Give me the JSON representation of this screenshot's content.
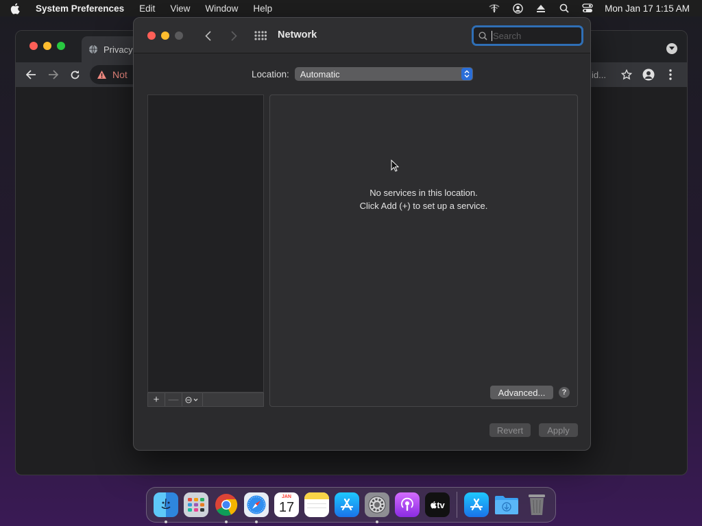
{
  "menubar": {
    "app_name": "System Preferences",
    "menus": [
      "Edit",
      "View",
      "Window",
      "Help"
    ],
    "status_icons": [
      "wifi-off-icon",
      "user-circle-icon",
      "eject-icon",
      "search-icon",
      "control-center-icon"
    ],
    "clock": "Mon Jan 17  1:15 AM"
  },
  "chrome": {
    "tab_title": "Privacy",
    "omnibox_text": "Not",
    "omnibox_right_fragment": "id..."
  },
  "prefs": {
    "title": "Network",
    "search_placeholder": "Search",
    "location_label": "Location:",
    "location_value": "Automatic",
    "empty_line1": "No services in this location.",
    "empty_line2": "Click Add (+) to set up a service.",
    "add_label": "+",
    "remove_label": "—",
    "advanced_label": "Advanced...",
    "help_label": "?",
    "revert_label": "Revert",
    "apply_label": "Apply"
  },
  "dock": {
    "apps": [
      {
        "name": "finder",
        "running": true
      },
      {
        "name": "launchpad",
        "running": false
      },
      {
        "name": "chrome",
        "running": true
      },
      {
        "name": "safari",
        "running": true
      },
      {
        "name": "calendar",
        "running": false,
        "month": "JAN",
        "day": "17"
      },
      {
        "name": "notes",
        "running": false
      },
      {
        "name": "app-store",
        "running": false
      },
      {
        "name": "system-preferences",
        "running": true
      },
      {
        "name": "podcasts",
        "running": false
      },
      {
        "name": "apple-tv",
        "running": false,
        "label": "tv"
      }
    ],
    "right": [
      "app-store-folder",
      "downloads-folder",
      "trash"
    ]
  },
  "colors": {
    "accent": "#2f6fb6",
    "close": "#fe5f57",
    "minimize": "#febc2e",
    "zoom": "#28c840"
  }
}
